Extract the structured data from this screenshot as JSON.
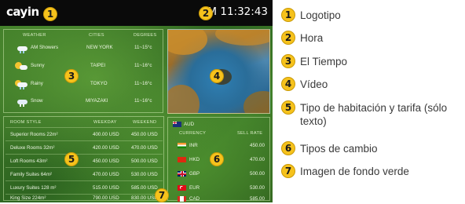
{
  "screen": {
    "logo": "cayin",
    "clock": "AM 11:32:43",
    "weather": {
      "headers": [
        "WEATHER",
        "CITIES",
        "DEGREES"
      ],
      "rows": [
        {
          "condition": "AM Showers",
          "icon": "cloud-rain-icon",
          "city": "NEW YORK",
          "degrees": "11~15°c"
        },
        {
          "condition": "Sunny",
          "icon": "sun-icon",
          "city": "TAIPEI",
          "degrees": "11~16°c"
        },
        {
          "condition": "Rainy",
          "icon": "cloud-rain-icon",
          "city": "TOKYO",
          "degrees": "11~16°c"
        },
        {
          "condition": "Snow",
          "icon": "cloud-snow-icon",
          "city": "MIYAZAKI",
          "degrees": "11~16°c"
        }
      ]
    },
    "rooms": {
      "headers": [
        "ROOM STYLE",
        "WEEKDAY",
        "WEEKEND"
      ],
      "rows": [
        {
          "style": "Superior Rooms 22m²",
          "weekday": "400.00 USD",
          "weekend": "450.00 USD"
        },
        {
          "style": "Deluxe Rooms 32m²",
          "weekday": "420.00 USD",
          "weekend": "470.00 USD"
        },
        {
          "style": "Loft Rooms 43m²",
          "weekday": "450.00 USD",
          "weekend": "500.00 USD"
        },
        {
          "style": "Family Suites 64m²",
          "weekday": "470.00 USD",
          "weekend": "530.00 USD"
        },
        {
          "style": "Luxury Suites 128 m²",
          "weekday": "515.00 USD",
          "weekend": "585.00 USD"
        },
        {
          "style": "King Size 224m²",
          "weekday": "790.00 USD",
          "weekend": "830.00 USD"
        }
      ]
    },
    "currency": {
      "base": "AUD",
      "headers": [
        "CURRENCY",
        "SELL RATE"
      ],
      "rows": [
        {
          "code": "INR",
          "rate": "450.00",
          "flag": "india-flag-icon"
        },
        {
          "code": "HKD",
          "rate": "470.00",
          "flag": "hong-kong-flag-icon"
        },
        {
          "code": "GBP",
          "rate": "500.00",
          "flag": "uk-flag-icon"
        },
        {
          "code": "EUR",
          "rate": "530.00",
          "flag": "turkey-flag-icon"
        },
        {
          "code": "CAD",
          "rate": "585.00",
          "flag": "canada-flag-icon"
        }
      ]
    },
    "markers": [
      "1",
      "2",
      "3",
      "4",
      "5",
      "6",
      "7"
    ]
  },
  "legend": [
    {
      "num": "1",
      "text": "Logotipo"
    },
    {
      "num": "2",
      "text": "Hora"
    },
    {
      "num": "3",
      "text": "El Tiempo"
    },
    {
      "num": "4",
      "text": "Vídeo"
    },
    {
      "num": "5",
      "text": "Tipo de habitación y tarifa (sólo texto)"
    },
    {
      "num": "6",
      "text": "Tipos de cambio"
    },
    {
      "num": "7",
      "text": "Imagen de fondo verde"
    }
  ],
  "colors": {
    "marker": "#f6c21c",
    "topbar": "#0a0a0a",
    "background": "#2c5a1e",
    "legend_text": "#3a3a3a"
  }
}
